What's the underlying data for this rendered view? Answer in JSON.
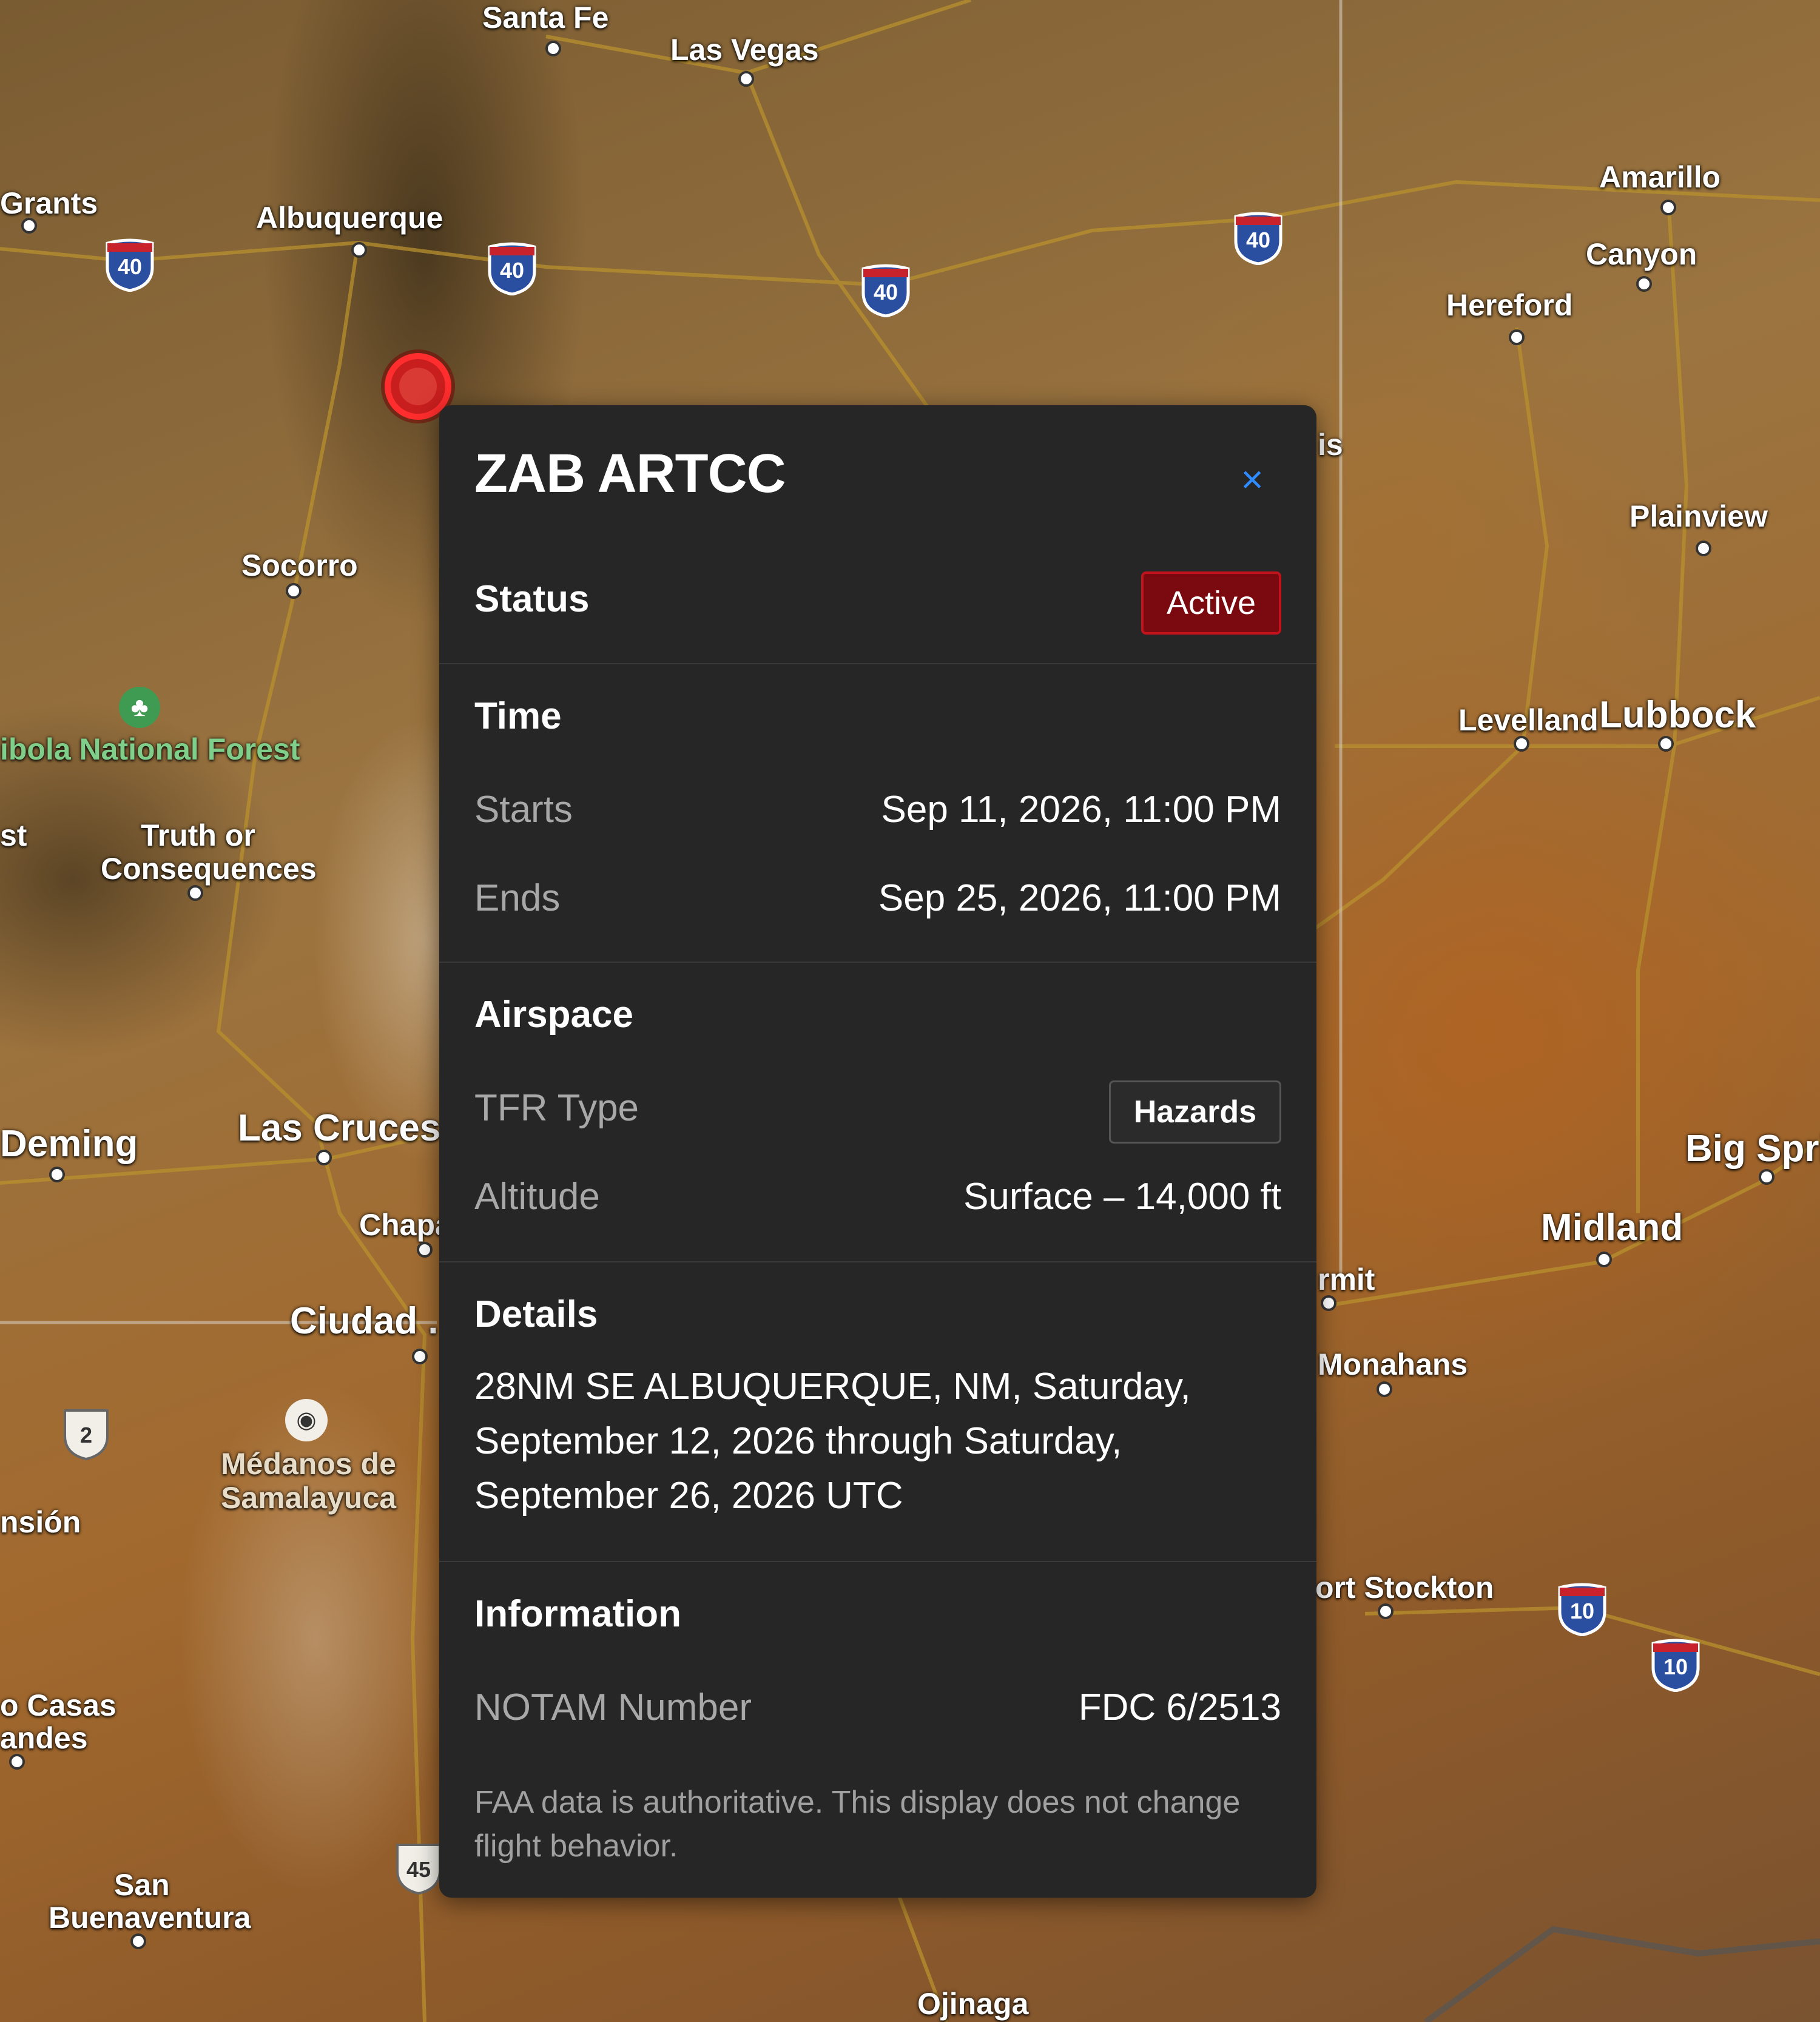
{
  "map": {
    "cities": [
      {
        "id": "santa-fe",
        "name": "Santa Fe"
      },
      {
        "id": "las-vegas",
        "name": "Las Vegas"
      },
      {
        "id": "grants",
        "name": "Grants"
      },
      {
        "id": "albuquerque",
        "name": "Albuquerque"
      },
      {
        "id": "amarillo",
        "name": "Amarillo"
      },
      {
        "id": "canyon",
        "name": "Canyon"
      },
      {
        "id": "hereford",
        "name": "Hereford"
      },
      {
        "id": "clovis-partial",
        "name": "is"
      },
      {
        "id": "plainview",
        "name": "Plainview"
      },
      {
        "id": "socorro",
        "name": "Socorro"
      },
      {
        "id": "cibola",
        "name": "ibola National Forest"
      },
      {
        "id": "st-partial",
        "name": "st"
      },
      {
        "id": "truth-or-consequences-1",
        "name": "Truth or"
      },
      {
        "id": "truth-or-consequences-2",
        "name": "Consequences"
      },
      {
        "id": "levelland",
        "name": "Levelland"
      },
      {
        "id": "lubbock",
        "name": "Lubbock"
      },
      {
        "id": "deming",
        "name": "Deming"
      },
      {
        "id": "las-cruces",
        "name": "Las Cruces"
      },
      {
        "id": "chaparral",
        "name": "Chapa"
      },
      {
        "id": "big-spring",
        "name": "Big Sprir"
      },
      {
        "id": "midland",
        "name": "Midland"
      },
      {
        "id": "kermit",
        "name": "rmit"
      },
      {
        "id": "ciudad-juarez",
        "name": "Ciudad ."
      },
      {
        "id": "monahans",
        "name": "Monahans"
      },
      {
        "id": "medanos-1",
        "name": "Médanos de"
      },
      {
        "id": "medanos-2",
        "name": "Samalayuca"
      },
      {
        "id": "ascension",
        "name": "nsión"
      },
      {
        "id": "fort-stockton",
        "name": "ort Stockton"
      },
      {
        "id": "casas-grandes-1",
        "name": "o Casas"
      },
      {
        "id": "casas-grandes-2",
        "name": "andes"
      },
      {
        "id": "san-buenaventura-1",
        "name": "San"
      },
      {
        "id": "san-buenaventura-2",
        "name": "Buenaventura"
      },
      {
        "id": "ojinaga",
        "name": "Ojinaga"
      }
    ],
    "shields": [
      "40",
      "40",
      "40",
      "40",
      "10",
      "10",
      "2",
      "45"
    ]
  },
  "panel": {
    "title": "ZAB ARTCC",
    "close_label": "×",
    "status": {
      "label": "Status",
      "value": "Active"
    },
    "time": {
      "title": "Time",
      "starts_label": "Starts",
      "starts_value": "Sep 11, 2026, 11:00 PM",
      "ends_label": "Ends",
      "ends_value": "Sep 25, 2026, 11:00 PM"
    },
    "airspace": {
      "title": "Airspace",
      "type_label": "TFR Type",
      "type_value": "Hazards",
      "altitude_label": "Altitude",
      "altitude_value": "Surface – 14,000 ft"
    },
    "details": {
      "title": "Details",
      "text": "28NM SE ALBUQUERQUE, NM, Saturday, September 12, 2026 through Saturday, September 26, 2026 UTC"
    },
    "information": {
      "title": "Information",
      "notam_label": "NOTAM Number",
      "notam_value": "FDC 6/2513"
    },
    "footnote": "FAA data is authoritative. This display does not change flight behavior."
  },
  "colors": {
    "panel_bg": "#262626",
    "accent_blue": "#2f8cff",
    "status_active_bg": "#7a0a0f",
    "status_active_border": "#c2121b",
    "tfr_marker": "#ff2d2d"
  }
}
